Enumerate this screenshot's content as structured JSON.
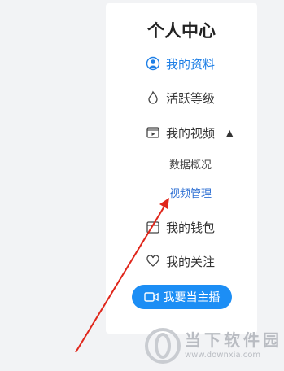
{
  "panel": {
    "title": "个人中心",
    "items": [
      {
        "label": "我的资料",
        "icon": "profile-icon",
        "active": true
      },
      {
        "label": "活跃等级",
        "icon": "flame-icon"
      },
      {
        "label": "我的视频",
        "icon": "video-icon",
        "expanded": true
      },
      {
        "label": "我的钱包",
        "icon": "wallet-icon"
      },
      {
        "label": "我的关注",
        "icon": "heart-icon"
      }
    ],
    "sub_items": [
      {
        "label": "数据概况"
      },
      {
        "label": "视频管理",
        "active": true
      }
    ],
    "live_button": "我要当主播"
  },
  "watermark": {
    "title": "当下软件园",
    "url": "www.downxia.com"
  },
  "colors": {
    "accent": "#1e7fe6",
    "button": "#1c8ef5",
    "arrow": "#e0261b",
    "background": "#f2f3f5"
  }
}
